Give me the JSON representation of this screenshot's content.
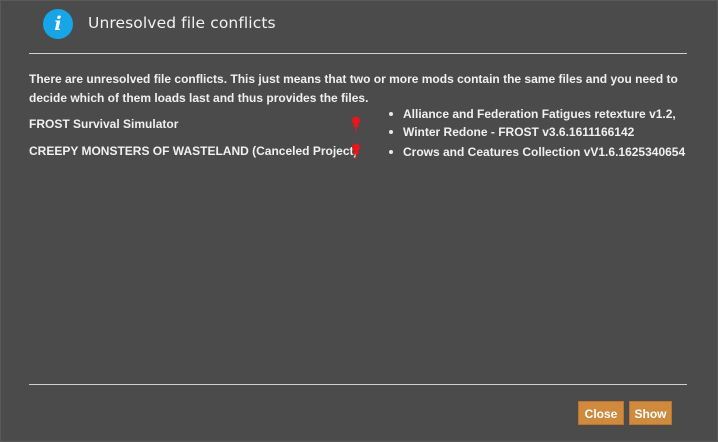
{
  "dialog": {
    "title": "Unresolved file conflicts",
    "icon": "info-icon",
    "description": "There are unresolved file conflicts. This just means that two or more mods contain the same files and you need to decide which of them loads last and thus provides the files."
  },
  "conflicts": [
    {
      "mod": "FROST Survival Simulator",
      "icon": "pin-icon",
      "files": [
        "Alliance and Federation Fatigues retexture v1.2,",
        "Winter Redone - FROST v3.6.1611166142"
      ]
    },
    {
      "mod": "CREEPY MONSTERS OF WASTELAND (Canceled Project)",
      "icon": "pin-icon",
      "files": [
        "Crows and Ceatures Collection vV1.6.1625340654"
      ]
    }
  ],
  "buttons": {
    "close": "Close",
    "show": "Show"
  },
  "colors": {
    "background": "#4b4b4b",
    "accent": "#d08a3e",
    "info": "#18a5e8",
    "pin": "#e8171a"
  }
}
